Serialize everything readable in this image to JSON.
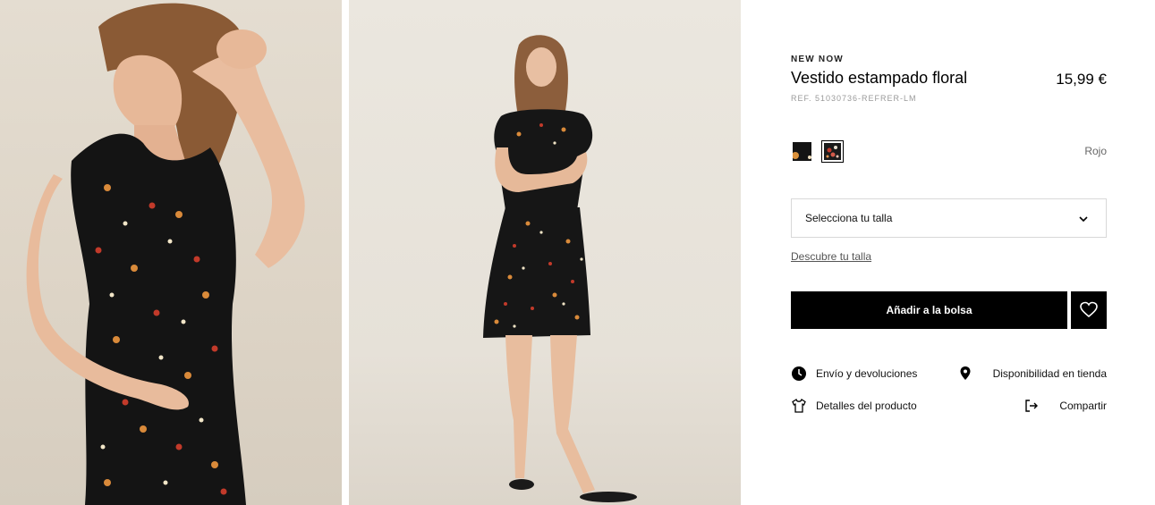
{
  "product": {
    "tag": "NEW NOW",
    "title": "Vestido estampado floral",
    "price": "15,99 €",
    "ref": "REF. 51030736-REFRER-LM"
  },
  "colors": {
    "selected_name": "Rojo",
    "swatches": [
      "black-orange-swatch",
      "black-floral-swatch"
    ]
  },
  "size": {
    "placeholder": "Selecciona tu talla",
    "guide_link": "Descubre tu talla"
  },
  "actions": {
    "add_to_bag": "Añadir a la bolsa",
    "favorite_icon": "heart-icon"
  },
  "info_links": {
    "shipping": "Envío y devoluciones",
    "store_availability": "Disponibilidad en tienda",
    "product_details": "Detalles del producto",
    "share": "Compartir"
  },
  "theme": {
    "button_bg": "#000000",
    "button_text": "#ffffff",
    "muted_text": "#999999"
  }
}
